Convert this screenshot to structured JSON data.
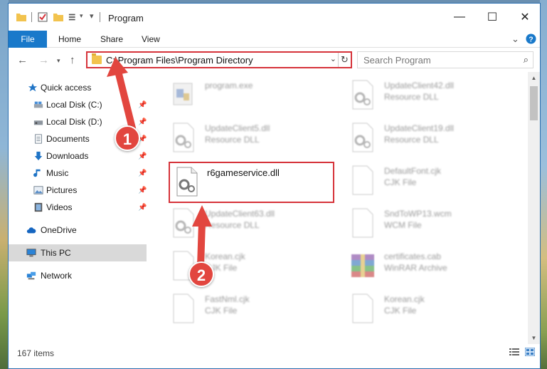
{
  "window": {
    "title": "Program"
  },
  "ribbon": {
    "tabs": [
      "File",
      "Home",
      "Share",
      "View"
    ]
  },
  "address": {
    "path": "C:\\Program Files\\Program Directory"
  },
  "search": {
    "placeholder": "Search Program"
  },
  "sidebar": {
    "items": [
      {
        "label": "Quick access",
        "icon": "star-icon"
      },
      {
        "label": "Local Disk (C:)",
        "icon": "drive-icon",
        "pinned": true
      },
      {
        "label": "Local Disk (D:)",
        "icon": "drive-icon",
        "pinned": true
      },
      {
        "label": "Documents",
        "icon": "documents-icon",
        "pinned": true
      },
      {
        "label": "Downloads",
        "icon": "download-icon",
        "pinned": true
      },
      {
        "label": "Music",
        "icon": "music-icon",
        "pinned": true
      },
      {
        "label": "Pictures",
        "icon": "pictures-icon",
        "pinned": true
      },
      {
        "label": "Videos",
        "icon": "videos-icon",
        "pinned": true
      },
      {
        "label": "OneDrive",
        "icon": "cloud-icon"
      },
      {
        "label": "This PC",
        "icon": "computer-icon",
        "selected": true
      },
      {
        "label": "Network",
        "icon": "network-icon"
      }
    ]
  },
  "files": {
    "left": [
      {
        "name": "program.exe",
        "type": ""
      },
      {
        "name": "UpdateClient5.dll",
        "type": "Resource DLL"
      },
      {
        "name": "r6gameservice.dll",
        "type": ""
      },
      {
        "name": "UpdateClient63.dll",
        "type": "Resource DLL"
      },
      {
        "name": "Korean.cjk",
        "type": "CJK File"
      },
      {
        "name": "FastNml.cjk",
        "type": "CJK File"
      }
    ],
    "right": [
      {
        "name": "UpdateClient42.dll",
        "type": "Resource DLL"
      },
      {
        "name": "UpdateClient19.dll",
        "type": "Resource DLL"
      },
      {
        "name": "DefaultFont.cjk",
        "type": "CJK File"
      },
      {
        "name": "SndToWP13.wcm",
        "type": "WCM File"
      },
      {
        "name": "certificates.cab",
        "type": "WinRAR Archive"
      },
      {
        "name": "Korean.cjk",
        "type": "CJK File"
      }
    ]
  },
  "status": {
    "items": "167 items"
  },
  "annotations": {
    "step1": "1",
    "step2": "2"
  },
  "colors": {
    "accent": "#1979ca",
    "highlight": "#d6333a",
    "arrow": "#e2463f"
  }
}
